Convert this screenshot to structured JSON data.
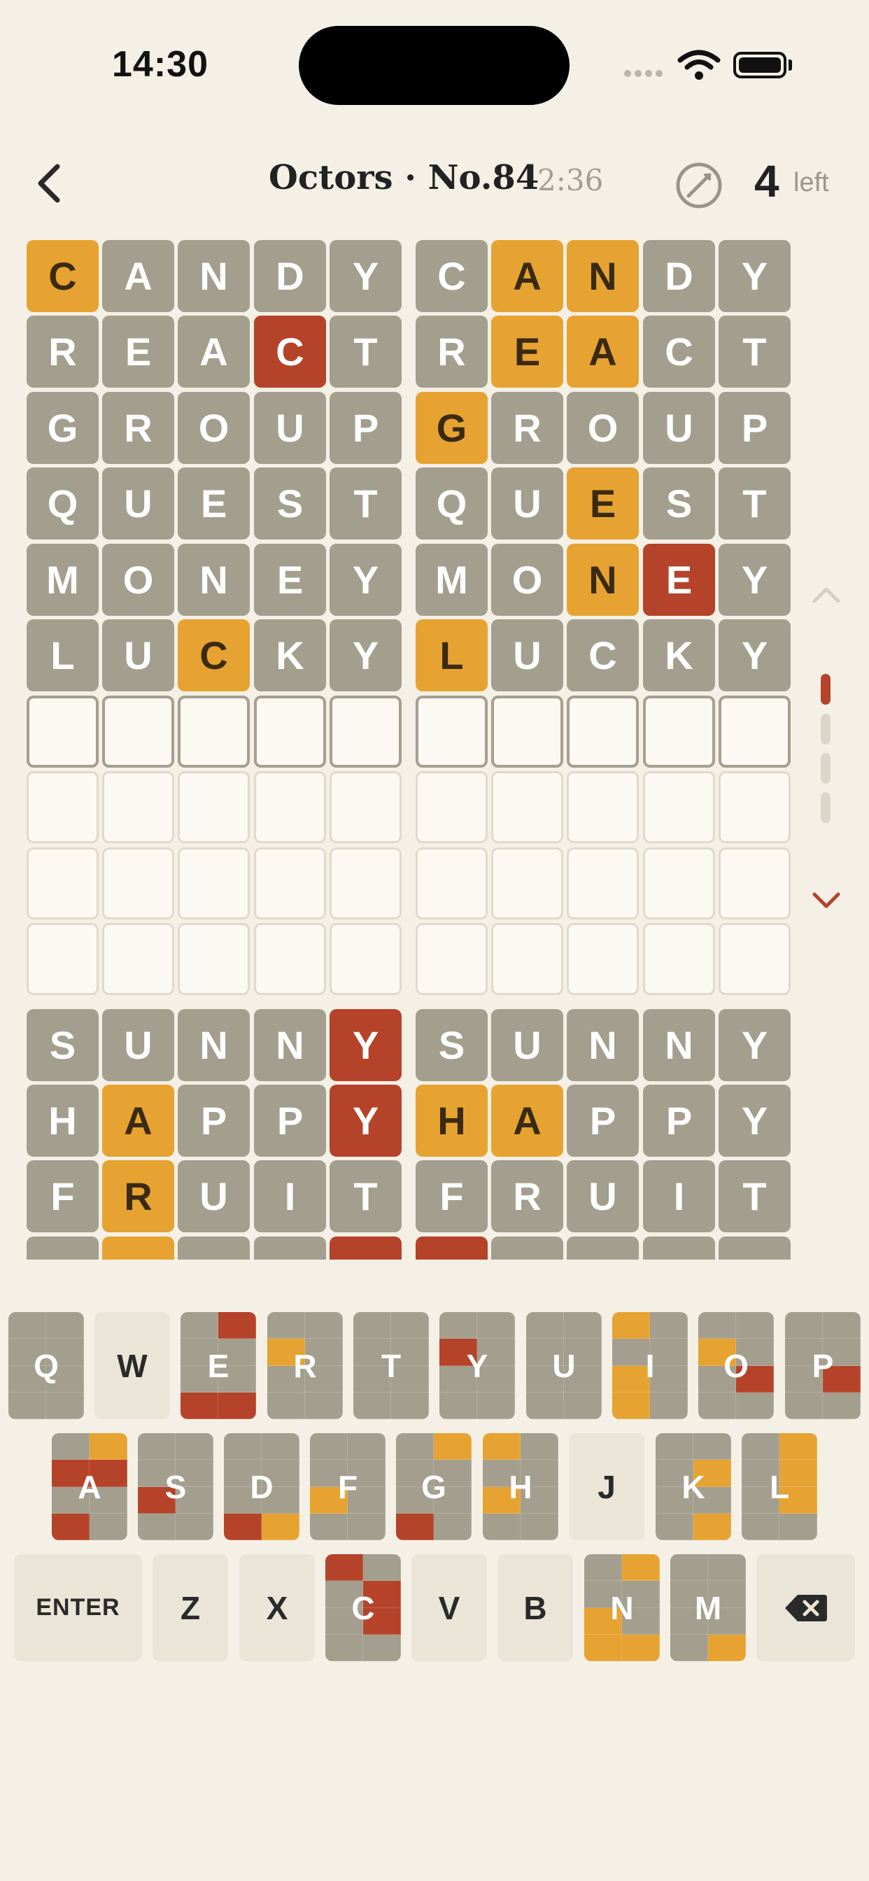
{
  "status_bar": {
    "time": "14:30"
  },
  "header": {
    "title": "Octors · No.84",
    "timer": "2:36",
    "remaining": "4",
    "remaining_label": "left"
  },
  "colors": {
    "gray": "#a49e8e",
    "yellow": "#e6a332",
    "red": "#b5432a",
    "background": "#f5f0e6",
    "key_unused": "#ebe5d8"
  },
  "icons": {
    "back": "chevron-left-icon",
    "compass": "compass-icon",
    "scroll_up": "chevron-up-icon",
    "scroll_down": "chevron-down-icon",
    "backspace": "backspace-icon"
  },
  "boards": [
    {
      "guesses": [
        {
          "word": "CANDY",
          "marks": "ygggg"
        },
        {
          "word": "REACT",
          "marks": "gggrg"
        },
        {
          "word": "GROUP",
          "marks": "ggggg"
        },
        {
          "word": "QUEST",
          "marks": "ggggg"
        },
        {
          "word": "MONEY",
          "marks": "ggggg"
        },
        {
          "word": "LUCKY",
          "marks": "ggygg"
        }
      ],
      "empty_rows": 4
    },
    {
      "guesses": [
        {
          "word": "CANDY",
          "marks": "gyygg"
        },
        {
          "word": "REACT",
          "marks": "gyygg"
        },
        {
          "word": "GROUP",
          "marks": "ygggg"
        },
        {
          "word": "QUEST",
          "marks": "ggygg"
        },
        {
          "word": "MONEY",
          "marks": "ggyrg"
        },
        {
          "word": "LUCKY",
          "marks": "ygggg"
        }
      ],
      "empty_rows": 4
    },
    {
      "guesses": [
        {
          "word": "SUNNY",
          "marks": "ggggr"
        },
        {
          "word": "HAPPY",
          "marks": "gyggr"
        },
        {
          "word": "FRUIT",
          "marks": "gyggg"
        },
        {
          "word": "",
          "marks": "gyggr"
        }
      ]
    },
    {
      "guesses": [
        {
          "word": "SUNNY",
          "marks": "ggggg"
        },
        {
          "word": "HAPPY",
          "marks": "yyggg"
        },
        {
          "word": "FRUIT",
          "marks": "ggggg"
        },
        {
          "word": "",
          "marks": "rgggg"
        }
      ]
    }
  ],
  "pager": {
    "pages": 4,
    "current": 0
  },
  "keyboard": {
    "rows": [
      [
        {
          "label": "Q",
          "grid": "gggggggg"
        },
        {
          "label": "W",
          "grid": ""
        },
        {
          "label": "E",
          "grid": "grggggrr"
        },
        {
          "label": "R",
          "grid": "ggyggggg"
        },
        {
          "label": "T",
          "grid": "gggggggg"
        },
        {
          "label": "Y",
          "grid": "ggrggggg"
        },
        {
          "label": "U",
          "grid": "gggggggg"
        },
        {
          "label": "I",
          "grid": "ygggygyg"
        },
        {
          "label": "O",
          "grid": "ggyggrgg"
        },
        {
          "label": "P",
          "grid": "gggggrgg"
        }
      ],
      [
        {
          "label": "A",
          "grid": "gyrrggrg"
        },
        {
          "label": "S",
          "grid": "ggggrggg"
        },
        {
          "label": "D",
          "grid": "ggggggry"
        },
        {
          "label": "F",
          "grid": "ggggyggg"
        },
        {
          "label": "G",
          "grid": "gyggggrg"
        },
        {
          "label": "H",
          "grid": "ygggyggg"
        },
        {
          "label": "J",
          "grid": ""
        },
        {
          "label": "K",
          "grid": "gggygggy"
        },
        {
          "label": "L",
          "grid": "gygygygg"
        }
      ],
      [
        {
          "label": "ENTER",
          "grid": ""
        },
        {
          "label": "Z",
          "grid": ""
        },
        {
          "label": "X",
          "grid": ""
        },
        {
          "label": "C",
          "grid": "rggrgrgg"
        },
        {
          "label": "V",
          "grid": ""
        },
        {
          "label": "B",
          "grid": ""
        },
        {
          "label": "N",
          "grid": "gyggygyy"
        },
        {
          "label": "M",
          "grid": "gggggggy"
        },
        {
          "label": "",
          "icon": "backspace",
          "grid": ""
        }
      ]
    ]
  }
}
